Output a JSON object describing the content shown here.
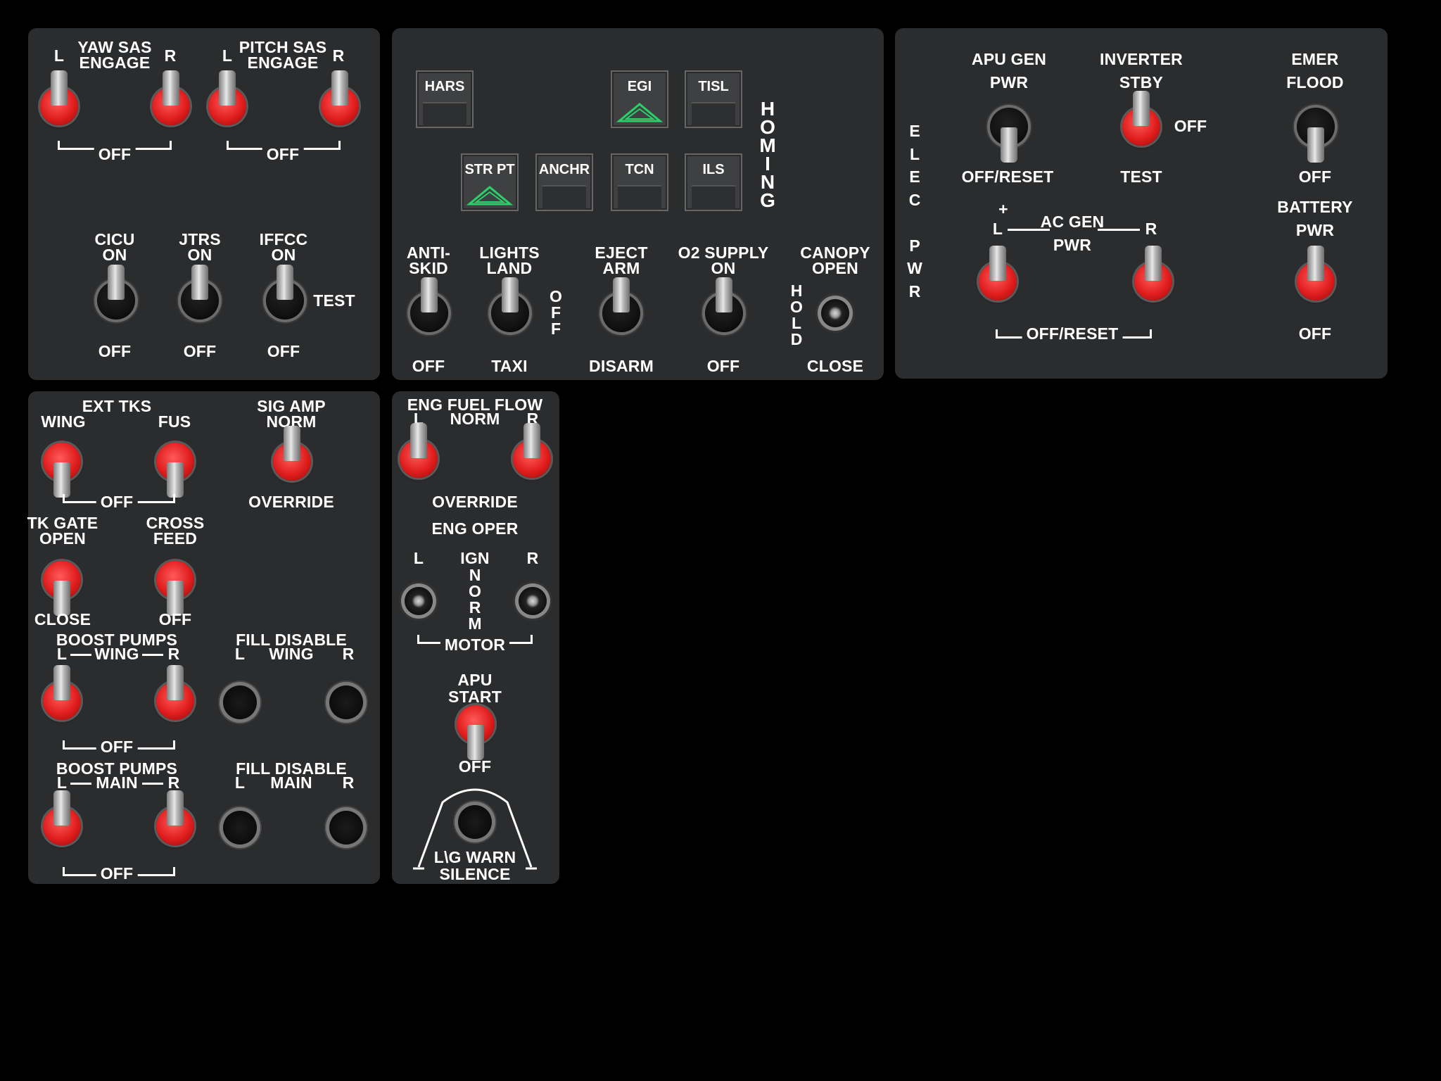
{
  "panel1": {
    "yaw_sas": {
      "l": "L",
      "title": "YAW SAS\nENGAGE",
      "r": "R",
      "off": "OFF"
    },
    "pitch_sas": {
      "l": "L",
      "title": "PITCH SAS\nENGAGE",
      "r": "R",
      "off": "OFF"
    },
    "cicu": {
      "top": "CICU\nON",
      "bottom": "OFF"
    },
    "jtrs": {
      "top": "JTRS\nON",
      "bottom": "OFF"
    },
    "iffcc": {
      "top": "IFFCC\nON",
      "bottom": "OFF",
      "side": "TEST"
    }
  },
  "panel2": {
    "indicators": {
      "hars": "HARS",
      "egi": "EGI",
      "tisl": "TISL",
      "str_pt": "STR PT",
      "anchr": "ANCHR",
      "tcn": "TCN",
      "ils": "ILS"
    },
    "homing": "H\nO\nM\nI\nN\nG",
    "anti_skid": {
      "top": "ANTI-\nSKID",
      "bottom": "OFF"
    },
    "lights": {
      "top": "LIGHTS\nLAND",
      "bottom": "TAXI",
      "side": "O\nF\nF"
    },
    "eject": {
      "top": "EJECT\nARM",
      "bottom": "DISARM"
    },
    "o2": {
      "top": "O2 SUPPLY\nON",
      "bottom": "OFF"
    },
    "canopy": {
      "top": "CANOPY\nOPEN",
      "bottom": "CLOSE",
      "side": "H\nO\nL\nD"
    }
  },
  "panel3": {
    "elec_pwr": "E\nL\nE\nC\n\nP\nW\nR",
    "apu_gen": {
      "top": "APU GEN\nPWR",
      "bottom": "OFF/RESET"
    },
    "inverter": {
      "top": "INVERTER\nSTBY",
      "bottom": "TEST",
      "side": "OFF"
    },
    "emer_flood": {
      "top": "EMER\nFLOOD",
      "bottom": "OFF"
    },
    "ac_gen": {
      "plus": "+",
      "l": "L",
      "title": "AC GEN\nPWR",
      "r": "R",
      "off": "OFF/RESET"
    },
    "battery": {
      "top": "BATTERY\nPWR",
      "bottom": "OFF"
    }
  },
  "panel4": {
    "ext_tks": {
      "title": "EXT TKS",
      "wing": "WING",
      "fus": "FUS",
      "off": "OFF"
    },
    "sig_amp": {
      "top": "SIG AMP\nNORM",
      "bottom": "OVERRIDE"
    },
    "tk_gate": {
      "top": "TK GATE\nOPEN",
      "bottom": "CLOSE"
    },
    "cross_feed": {
      "top": "CROSS\nFEED",
      "bottom": "OFF"
    },
    "boost_wing": {
      "title": "BOOST PUMPS",
      "l": "L",
      "mid": "WING",
      "r": "R",
      "off": "OFF"
    },
    "fill_wing": {
      "title": "FILL DISABLE",
      "l": "L",
      "mid": "WING",
      "r": "R"
    },
    "boost_main": {
      "title": "BOOST PUMPS",
      "l": "L",
      "mid": "MAIN",
      "r": "R",
      "off": "OFF"
    },
    "fill_main": {
      "title": "FILL DISABLE",
      "l": "L",
      "mid": "MAIN",
      "r": "R"
    }
  },
  "panel5": {
    "fuel_flow": {
      "title": "ENG FUEL FLOW",
      "l": "L",
      "norm": "NORM",
      "r": "R",
      "override": "OVERRIDE"
    },
    "eng_oper": {
      "title": "ENG OPER",
      "l": "L",
      "ign": "IGN",
      "r": "R",
      "norm": "N\nO\nR\nM",
      "motor": "MOTOR"
    },
    "apu_start": {
      "top": "APU\nSTART",
      "bottom": "OFF"
    },
    "lg_warn": {
      "label": "L\\G WARN\nSILENCE"
    }
  }
}
